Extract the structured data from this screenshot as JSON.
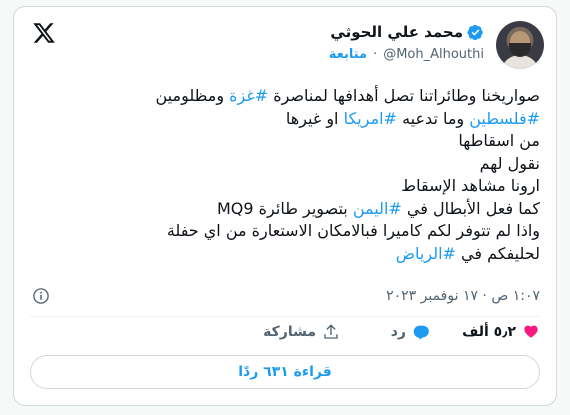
{
  "author": {
    "name": "محمد علي الحوثي",
    "handle": "@Moh_Alhouthi",
    "separator": "·",
    "follow_label": "متابعة"
  },
  "tweet": {
    "lines": [
      [
        {
          "t": "صواريخنا وطائراتنا تصل أهدافها لمناصرة "
        },
        {
          "t": "#غزة",
          "tag": true
        },
        {
          "t": " ومظلومين"
        }
      ],
      [
        {
          "t": "#فلسطين",
          "tag": true
        },
        {
          "t": " وما تدعيه "
        },
        {
          "t": "#امريكا",
          "tag": true
        },
        {
          "t": " او غيرها"
        }
      ],
      [
        {
          "t": " من اسقاطها"
        }
      ],
      [
        {
          "t": "نقول لهم"
        }
      ],
      [
        {
          "t": " ارونا مشاهد الإسقاط"
        }
      ],
      [
        {
          "t": " كما فعل الأبطال في "
        },
        {
          "t": "#اليمن",
          "tag": true
        },
        {
          "t": " بتصوير طائرة MQ9"
        }
      ],
      [
        {
          "t": "واذا لم تتوفر لكم كاميرا فبالامكان الاستعارة من اي حفلة"
        }
      ],
      [
        {
          "t": "لحليفكم في "
        },
        {
          "t": "#الرياض",
          "tag": true
        }
      ]
    ],
    "timestamp": "١:٠٧ ص · ١٧ نوفمبر ٢٠٢٣"
  },
  "actions": {
    "like_count": "٥٫٢ ألف",
    "reply_label": "رد",
    "share_label": "مشاركة"
  },
  "read_button_label": "قراءة ٦٣١ ردًا",
  "colors": {
    "accent": "#1d9bf0",
    "like": "#f91880",
    "muted": "#536471",
    "text": "#0f1419"
  },
  "icons": [
    "x-logo-icon",
    "verified-badge-icon",
    "info-icon",
    "heart-icon",
    "reply-bubble-icon",
    "share-icon"
  ]
}
